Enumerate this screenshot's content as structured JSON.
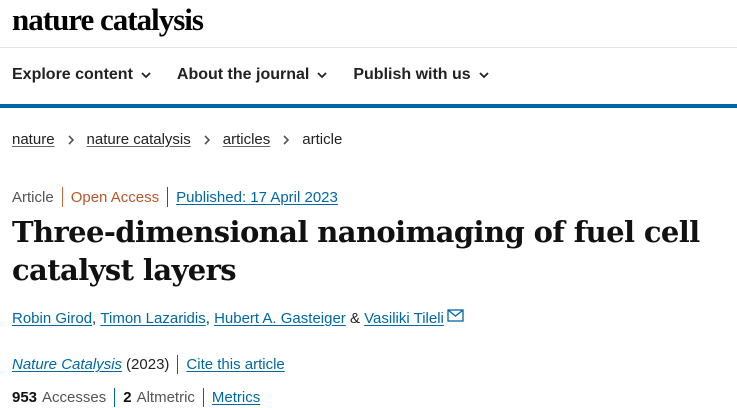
{
  "site": {
    "logo": "nature catalysis"
  },
  "nav": {
    "items": [
      {
        "label": "Explore content"
      },
      {
        "label": "About the journal"
      },
      {
        "label": "Publish with us"
      }
    ]
  },
  "breadcrumb": {
    "items": [
      "nature",
      "nature catalysis",
      "articles"
    ],
    "current": "article"
  },
  "article": {
    "type": "Article",
    "access": "Open Access",
    "published": "Published: 17 April 2023",
    "title": "Three-dimensional nanoimaging of fuel cell catalyst layers",
    "authors": [
      "Robin Girod",
      "Timon Lazaridis",
      "Hubert A. Gasteiger",
      "Vasiliki Tileli"
    ],
    "author_sep": ", ",
    "author_last_sep": " & ",
    "journal": "Nature Catalysis",
    "year": "(2023)",
    "cite_label": "Cite this article"
  },
  "metrics": {
    "accesses_value": "953",
    "accesses_label": "Accesses",
    "altmetric_value": "2",
    "altmetric_label": "Altmetric",
    "metrics_link": "Metrics"
  },
  "colors": {
    "accent": "#0067a5",
    "open_access": "#b8562a"
  },
  "icons": {
    "nav_dropdown": "chevron-down-icon",
    "crumb_sep": "chevron-right-icon",
    "author_contact": "mail-icon"
  }
}
